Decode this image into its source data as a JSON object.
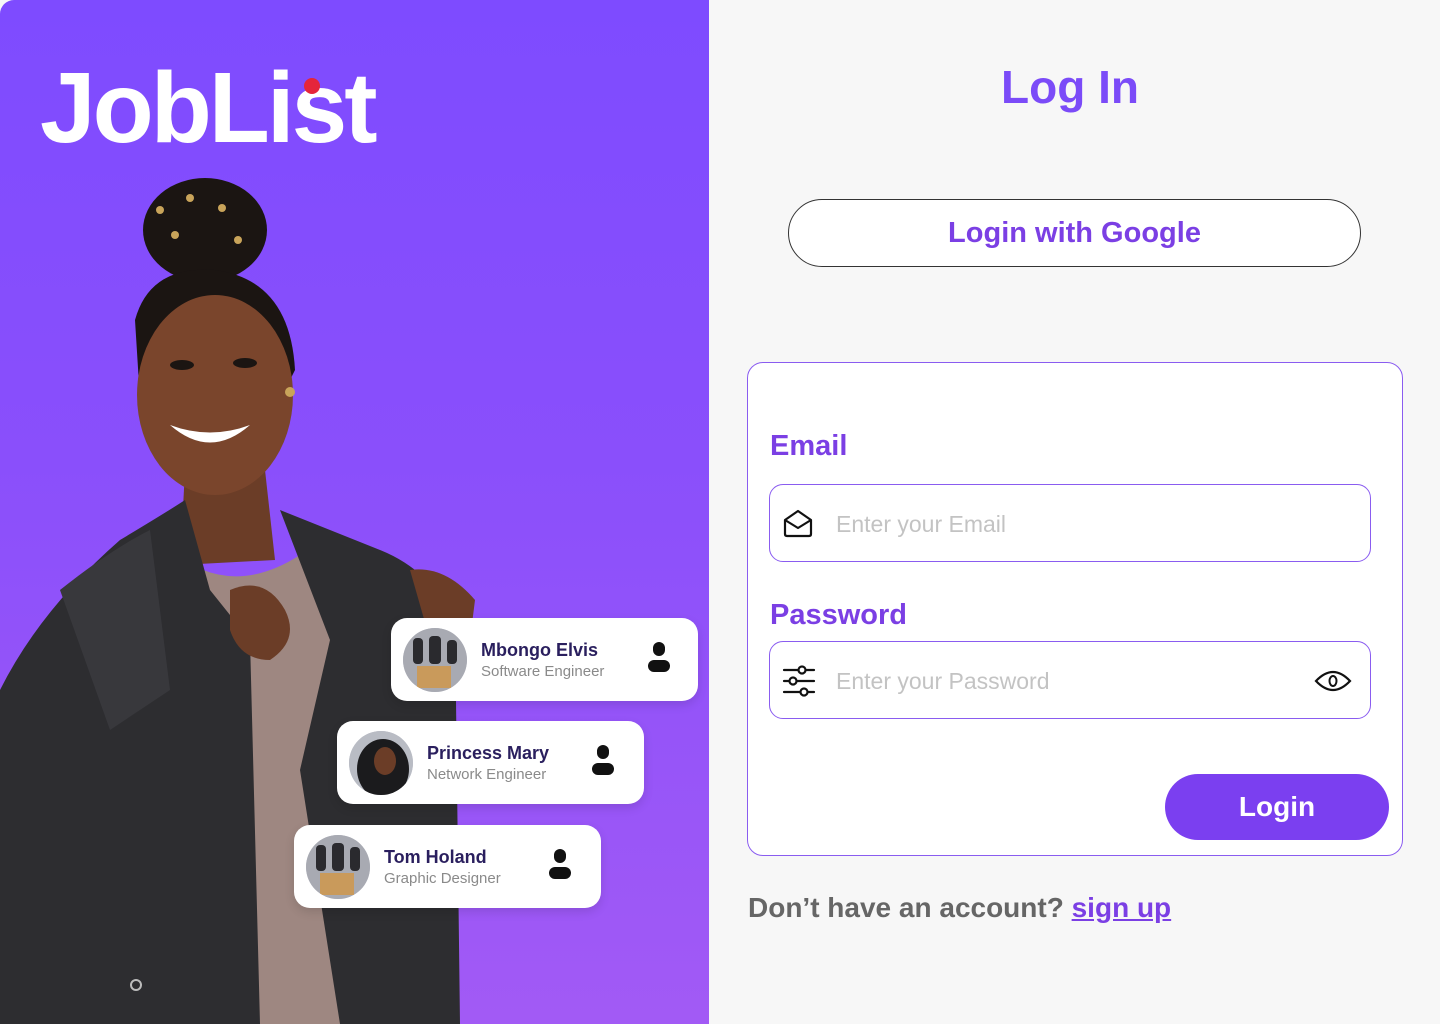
{
  "brand": {
    "name": "JobList"
  },
  "colors": {
    "primary": "#7b3fe4",
    "hero_top": "#7e4bff",
    "hero_bottom": "#a25af5",
    "dot": "#e5253a"
  },
  "profiles": [
    {
      "name": "Mbongo Elvis",
      "role": "Software Engineer",
      "icon": "user-icon"
    },
    {
      "name": "Princess Mary",
      "role": "Network Engineer",
      "icon": "user-icon"
    },
    {
      "name": "Tom Holand",
      "role": "Graphic Designer",
      "icon": "user-icon"
    }
  ],
  "form": {
    "title": "Log In",
    "google_label": "Login with Google",
    "email_label": "Email",
    "email_placeholder": "Enter your Email",
    "email_value": "",
    "password_label": "Password",
    "password_placeholder": "Enter your Password",
    "password_value": "",
    "submit_label": "Login",
    "signup_prompt": "Don’t have an account?",
    "signup_link": "sign up"
  },
  "icons": [
    "mail-icon",
    "sliders-icon",
    "eye-icon",
    "user-icon"
  ]
}
